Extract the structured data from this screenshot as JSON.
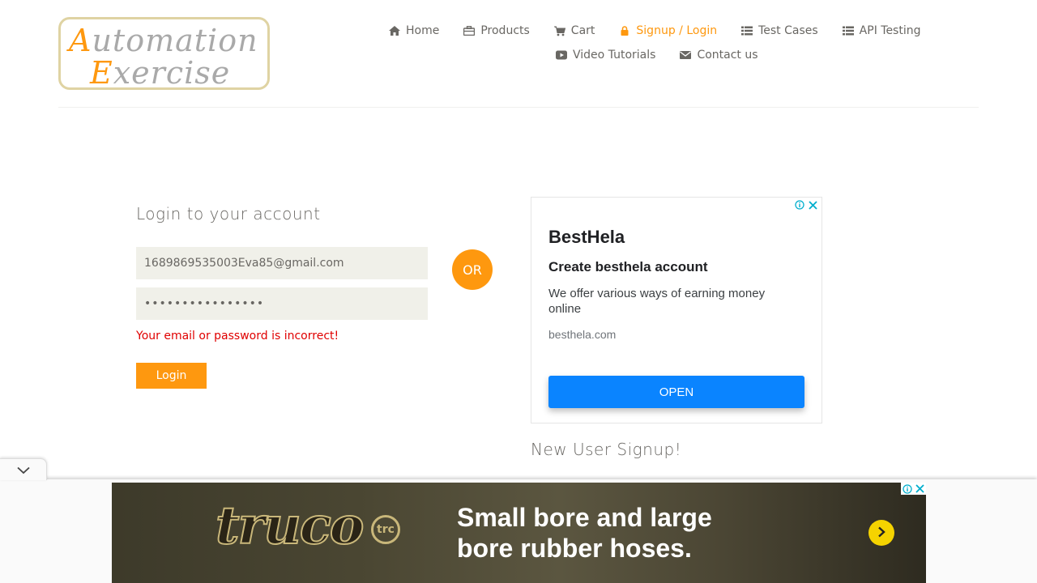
{
  "logo": {
    "line1_cap": "A",
    "line1_rest": "utomation",
    "line2_cap": "E",
    "line2_rest": "xercise"
  },
  "nav": {
    "items": [
      {
        "label": "Home",
        "icon": "home-icon",
        "active": false
      },
      {
        "label": "Products",
        "icon": "briefcase-icon",
        "active": false
      },
      {
        "label": "Cart",
        "icon": "cart-icon",
        "active": false
      },
      {
        "label": "Signup / Login",
        "icon": "lock-icon",
        "active": true
      },
      {
        "label": "Test Cases",
        "icon": "list-icon",
        "active": false
      },
      {
        "label": "API Testing",
        "icon": "list-icon",
        "active": false
      },
      {
        "label": "Video Tutorials",
        "icon": "youtube-icon",
        "active": false
      },
      {
        "label": "Contact us",
        "icon": "envelope-icon",
        "active": false
      }
    ]
  },
  "login": {
    "title": "Login to your account",
    "email_value": "1689869535003Eva85@gmail.com",
    "password_value": "••••••••••••••••",
    "error": "Your email or password is incorrect!",
    "button": "Login"
  },
  "or_label": "OR",
  "ad": {
    "brand": "BestHela",
    "headline": "Create besthela account",
    "body": "We offer various ways of earning money online",
    "url": "besthela.com",
    "cta": "OPEN"
  },
  "signup": {
    "title": "New User Signup!"
  },
  "banner": {
    "brand": "truco",
    "brand_mark": "trc",
    "headline_line1": "Small bore and large",
    "headline_line2": "bore rubber hoses."
  },
  "colors": {
    "accent": "#fe980f",
    "error": "#e00000",
    "ad_button": "#0a84ff",
    "field_bg": "#f0f0e9"
  }
}
